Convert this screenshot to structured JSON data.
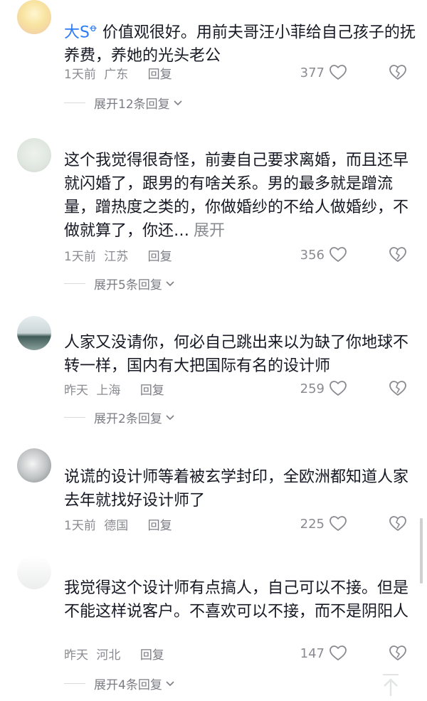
{
  "comments": [
    {
      "username": "",
      "author": "大S",
      "author_mark": "ꝋ",
      "text": "价值观很好。用前夫哥汪小菲给自己孩子的抚养费，养她的光头老公",
      "time": "1天前",
      "location": "广东",
      "reply": "回复",
      "likes": "377",
      "expand": "展开12条回复"
    },
    {
      "username": "",
      "text": "这个我觉得很奇怪，前妻自己要求离婚，而且还早就闪婚了，跟男的有啥关系。男的最多就是蹭流量，蹭热度之类的，你做婚纱的不给人做婚纱，不做就算了，你还…",
      "more": "展开",
      "time": "1天前",
      "location": "江苏",
      "reply": "回复",
      "likes": "356",
      "expand": "展开5条回复"
    },
    {
      "username": "",
      "text": "人家又没请你，何必自己跳出来以为缺了你地球不转一样，国内有大把国际有名的设计师",
      "time": "昨天",
      "location": "上海",
      "reply": "回复",
      "likes": "259",
      "expand": "展开2条回复"
    },
    {
      "username": "",
      "text": "说谎的设计师等着被玄学封印，全欧洲都知道人家去年就找好设计师了",
      "time": "1天前",
      "location": "德国",
      "reply": "回复",
      "likes": "225"
    },
    {
      "text": "我觉得这个设计师有点搞人，自己可以不接。但是不能这样说客户。不喜欢可以不接，而不是阴阳人",
      "time": "昨天",
      "location": "河北",
      "reply": "回复",
      "likes": "147",
      "expand": "展开4条回复"
    }
  ],
  "icons": {
    "like": "heart-outline-icon",
    "dislike": "broken-heart-icon",
    "expand": "chevron-down-icon",
    "back_to_top": "arrow-up-icon"
  },
  "colors": {
    "author": "#2c7cf6",
    "meta": "#8a8b91",
    "text": "#161823"
  }
}
